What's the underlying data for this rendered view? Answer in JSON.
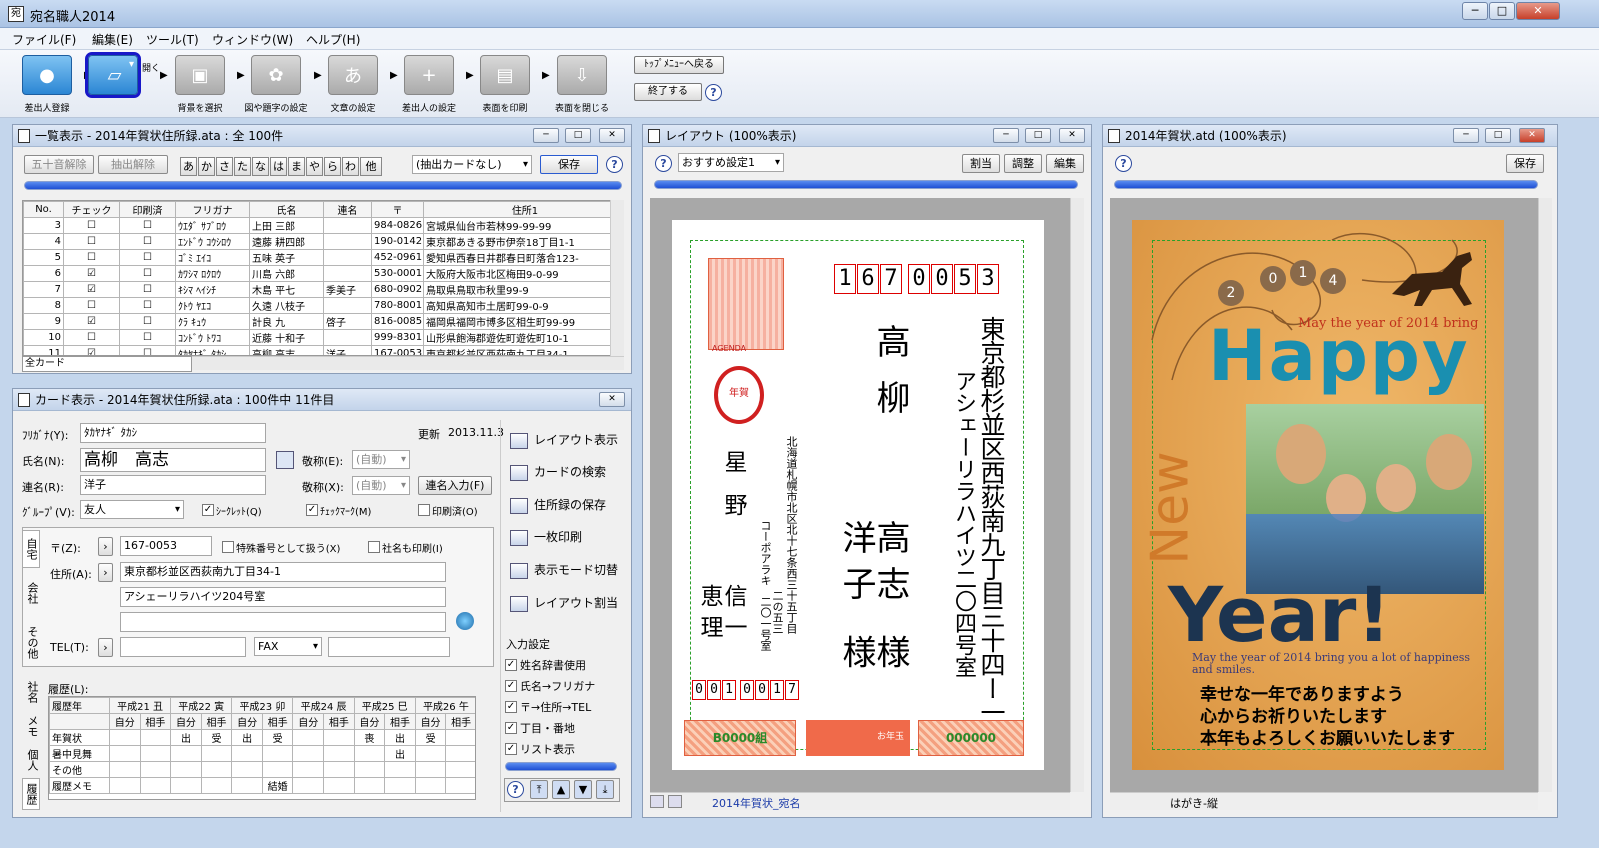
{
  "app": {
    "title": "宛名職人2014",
    "icon": "app-icon"
  },
  "menu": [
    "ファイル(F)",
    "編集(E)",
    "ツール(T)",
    "ウィンドウ(W)",
    "ヘルプ(H)"
  ],
  "toolbar": {
    "buttons": [
      {
        "label": "差出人登録",
        "icon": "person-icon"
      },
      {
        "label": "表面を作成・開く",
        "icon": "folder-open-icon"
      },
      {
        "label": "背景を選択",
        "icon": "image-icon"
      },
      {
        "label": "図や題字の設定",
        "icon": "figure-icon"
      },
      {
        "label": "文章の設定",
        "icon": "text-icon"
      },
      {
        "label": "差出人の設定",
        "icon": "add-person-icon"
      },
      {
        "label": "表面を印刷",
        "icon": "printer-icon"
      },
      {
        "label": "表面を閉じる",
        "icon": "download-icon"
      }
    ],
    "top_menu": "ﾄｯﾌﾟﾒﾆｭｰへ戻る",
    "exit": "終了する"
  },
  "list_panel": {
    "title": "一覧表示 - 2014年賀状住所録.ata : 全 100件",
    "clear_kana": "五十音解除",
    "clear_extract": "抽出解除",
    "kana": [
      "あ",
      "か",
      "さ",
      "た",
      "な",
      "は",
      "ま",
      "や",
      "ら",
      "わ",
      "他"
    ],
    "extract_select": "(抽出カードなし)",
    "save": "保存",
    "columns": [
      "No.",
      "チェック",
      "印刷済",
      "フリガナ",
      "氏名",
      "連名",
      "〒",
      "住所1"
    ],
    "rows": [
      {
        "no": "3",
        "check": "☐",
        "printed": "☐",
        "kana": "ｳｴﾀﾞ ｻﾌﾞﾛｳ",
        "name": "上田 三郎",
        "renmei": "",
        "zip": "984-0826",
        "addr": "宮城県仙台市若林99-99-99"
      },
      {
        "no": "4",
        "check": "☐",
        "printed": "☐",
        "kana": "ｴﾝﾄﾞｳ ｺｳｼﾛｳ",
        "name": "遠藤 耕四郎",
        "renmei": "",
        "zip": "190-0142",
        "addr": "東京都あきる野市伊奈18丁目1-1"
      },
      {
        "no": "5",
        "check": "☐",
        "printed": "☐",
        "kana": "ｺﾞﾐ ｴｲｺ",
        "name": "五味 英子",
        "renmei": "",
        "zip": "452-0961",
        "addr": "愛知県西春日井郡春日町落合123-"
      },
      {
        "no": "6",
        "check": "☑",
        "printed": "☐",
        "kana": "ｶﾜｼﾏ ﾛｸﾛｳ",
        "name": "川島 六郎",
        "renmei": "",
        "zip": "530-0001",
        "addr": "大阪府大阪市北区梅田9-0-99"
      },
      {
        "no": "7",
        "check": "☑",
        "printed": "☐",
        "kana": "ｷｼﾏ ﾍｲｼﾁ",
        "name": "木島 平七",
        "renmei": "季美子",
        "zip": "680-0902",
        "addr": "鳥取県鳥取市秋里99-9"
      },
      {
        "no": "8",
        "check": "☐",
        "printed": "☐",
        "kana": "ｸﾄｳ ﾔｴｺ",
        "name": "久遠 八枝子",
        "renmei": "",
        "zip": "780-8001",
        "addr": "高知県高知市土居町99-0-9"
      },
      {
        "no": "9",
        "check": "☑",
        "printed": "☐",
        "kana": "ｸﾗ ｷｭｳ",
        "name": "計良 九",
        "renmei": "啓子",
        "zip": "816-0085",
        "addr": "福岡県福岡市博多区相生町99-99"
      },
      {
        "no": "10",
        "check": "☐",
        "printed": "☐",
        "kana": "ｺﾝﾄﾞｳ ﾄﾜｺ",
        "name": "近藤 十和子",
        "renmei": "",
        "zip": "999-8301",
        "addr": "山形県飽海郡遊佐町遊佐町10-1"
      },
      {
        "no": "11",
        "check": "☑",
        "printed": "☐",
        "kana": "ﾀｶﾔﾅｷﾞ ﾀｶｼ",
        "name": "高柳 高志",
        "renmei": "洋子",
        "zip": "167-0053",
        "addr": "東京都杉並区西荻南九丁目34-1"
      }
    ],
    "footer_tab": "全カード"
  },
  "card_panel": {
    "title": "カード表示 - 2014年賀状住所録.ata : 100件中 11件目",
    "furigana_label": "ﾌﾘｶﾞﾅ(Y):",
    "furigana": "ﾀｶﾔﾅｷﾞ ﾀｶｼ",
    "updated_label": "更新",
    "updated": "2013.11.3",
    "name_label": "氏名(N):",
    "name": "高柳　高志",
    "honorific_label": "敬称(E):",
    "honorific": "(自動)",
    "renmei_label": "連名(R):",
    "renmei": "洋子",
    "honorific2_label": "敬称(X):",
    "honorific2": "(自動)",
    "renmei_input": "連名入力(F)",
    "group_label": "ｸﾞﾙｰﾌﾟ(V):",
    "group": "友人",
    "secret": "ｼｰｸﾚｯﾄ(Q)",
    "checkmark": "ﾁｪｯｸﾏｰｸ(M)",
    "printed": "印刷済(O)",
    "tabs": [
      "自宅",
      "会社",
      "その他",
      "社名",
      "メモ",
      "個人",
      "履歴"
    ],
    "zip_label": "〒(Z):",
    "zip": "167-0053",
    "special_number": "特殊番号として扱う(X)",
    "print_company": "社名も印刷(I)",
    "address_label": "住所(A):",
    "address1": "東京都杉並区西荻南九丁目34-1",
    "address2": "アシェーリラハイツ204号室",
    "address3": "",
    "tel_label": "TEL(T):",
    "fax": "FAX",
    "history_label": "履歴(L):",
    "history_years": [
      "履歴年",
      "平成21 丑",
      "平成22 寅",
      "平成23 卯",
      "平成24 辰",
      "平成25 巳",
      "平成26 午"
    ],
    "history_sub": [
      "自分",
      "相手"
    ],
    "history_rows": [
      {
        "label": "年賀状",
        "cells": [
          "",
          "",
          "出",
          "受",
          "出",
          "受",
          "",
          "",
          "喪",
          "出",
          "受",
          "",
          ""
        ]
      },
      {
        "label": "暑中見舞",
        "cells": [
          "",
          "",
          "",
          "",
          "",
          "",
          "",
          "",
          "",
          "出",
          "",
          "",
          ""
        ]
      },
      {
        "label": "その他",
        "cells": [
          "",
          "",
          "",
          "",
          "",
          "",
          "",
          "",
          "",
          "",
          "",
          "",
          ""
        ]
      },
      {
        "label": "履歴メモ",
        "cells": [
          "",
          "",
          "",
          "",
          "",
          "結婚",
          "",
          "",
          "",
          "",
          "",
          "",
          ""
        ]
      }
    ],
    "side_buttons": [
      {
        "label": "レイアウト表示",
        "icon": "layout-icon"
      },
      {
        "label": "カードの検索",
        "icon": "search-icon"
      },
      {
        "label": "住所録の保存",
        "icon": "save-icon"
      },
      {
        "label": "一枚印刷",
        "icon": "printer-icon"
      },
      {
        "label": "表示モード切替",
        "icon": "mode-icon"
      },
      {
        "label": "レイアウト割当",
        "icon": "assign-icon"
      }
    ],
    "input_settings_label": "入力設定",
    "input_settings": [
      "姓名辞書使用",
      "氏名→フリガナ",
      "〒→住所→TEL",
      "丁目・番地",
      "リスト表示"
    ]
  },
  "layout_panel": {
    "title": "レイアウト (100%表示)",
    "preset": "おすすめ設定1",
    "assign": "割当",
    "adjust": "調整",
    "edit": "編集",
    "recipient_zip": [
      "1",
      "6",
      "7",
      "0",
      "0",
      "5",
      "3"
    ],
    "recipient_address": "東京都杉並区西荻南九丁目三十四ー一",
    "recipient_address2": "アシェーリラハイツ二〇四号室",
    "recipient_name1": "高柳",
    "recipient_name2": "高志 様",
    "recipient_name3": "洋子 様",
    "sender_address": "北海道札幌市北区北十七条西三十五丁目",
    "sender_address2": "二の五三",
    "sender_building": "コーポアラキ",
    "sender_room": "二〇一号室",
    "sender_name1": "星野",
    "sender_name2": "信一",
    "sender_name3": "恵理",
    "sender_zip": [
      "0",
      "0",
      "1",
      "0",
      "0",
      "1",
      "7"
    ],
    "stamp": "年賀",
    "stamp2": "AGENDA",
    "lottery1": "B0000組",
    "lottery2": "お年玉",
    "lottery3": "000000",
    "footer": "2014年賀状_宛名"
  },
  "card_design_panel": {
    "title": "2014年賀状.atd (100%表示)",
    "save": "保存",
    "year_digits": [
      "2",
      "0",
      "1",
      "4"
    ],
    "tagline": "May the year of 2014 bring",
    "happy": "Happy",
    "new": "New",
    "year": "Year!",
    "tagline2": "May the year of 2014 bring you a lot of happiness and smiles.",
    "message": [
      "幸せな一年でありますよう",
      "心からお祈りいたします",
      "本年もよろしくお願いいたします"
    ],
    "footer": "はがき-縦"
  },
  "colors": {
    "accent": "#1f50d4",
    "zip_red": "#d00000",
    "card_bg": "#e8a44c",
    "happy_teal": "#1a8fb0",
    "new_orange": "#d07a2a",
    "year_navy": "#1c3450",
    "exclaim": "#c8201c"
  }
}
